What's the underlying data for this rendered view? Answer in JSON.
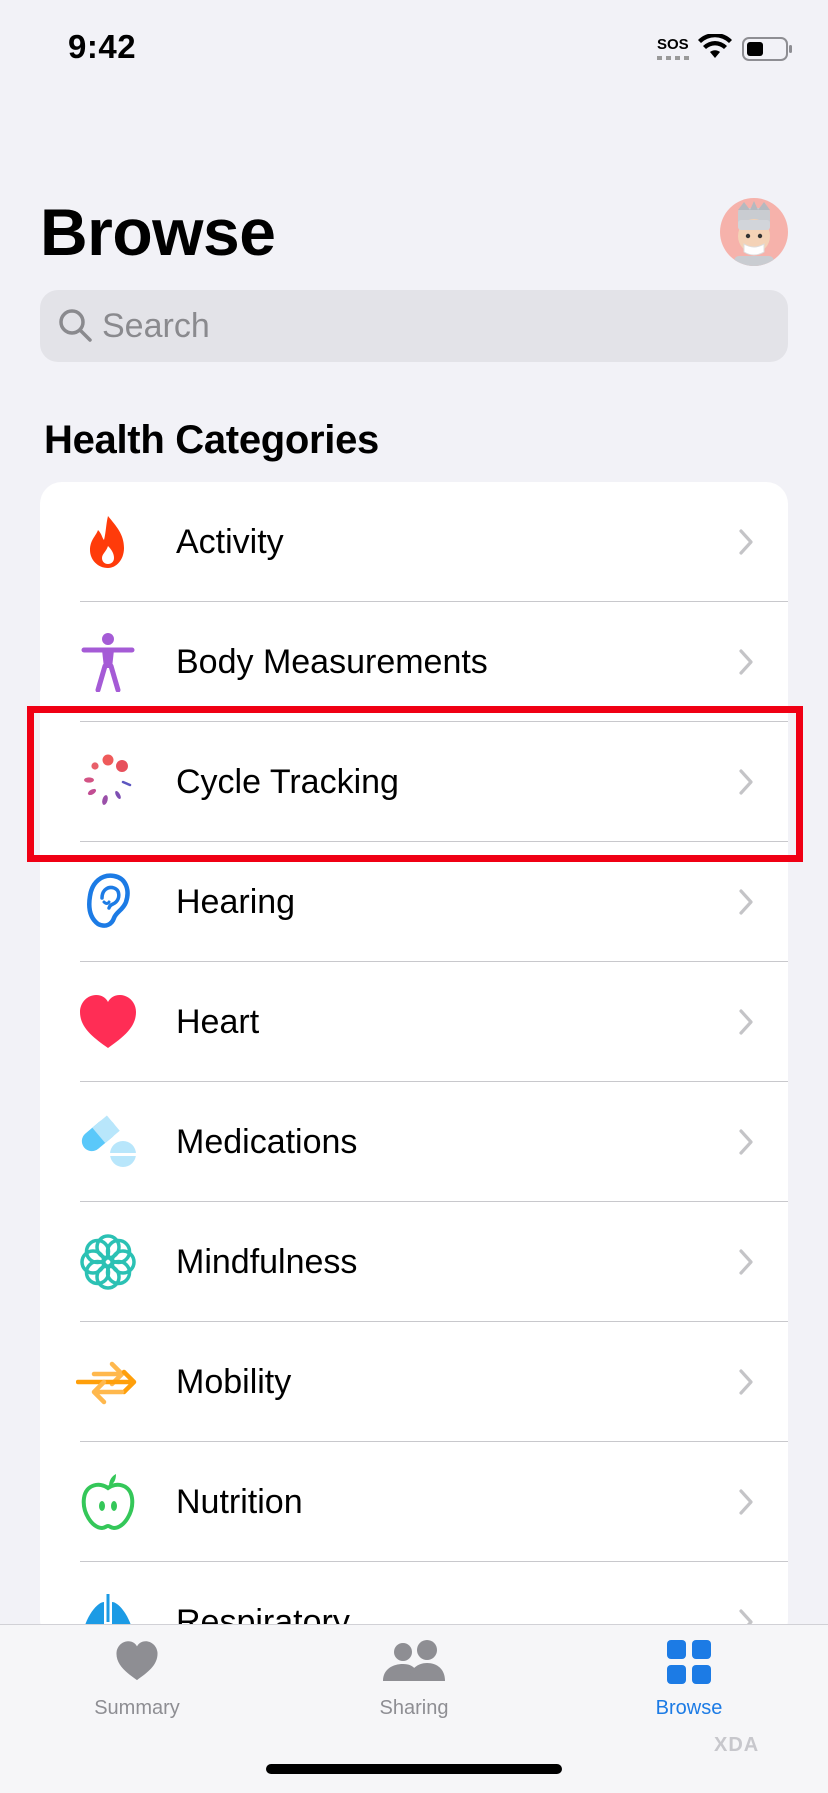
{
  "status_bar": {
    "time": "9:42",
    "carrier": "SOS"
  },
  "header": {
    "title": "Browse"
  },
  "search": {
    "placeholder": "Search"
  },
  "section": {
    "title": "Health Categories"
  },
  "categories": [
    {
      "label": "Activity",
      "icon": "flame-icon",
      "color": "#FF3B0A"
    },
    {
      "label": "Body Measurements",
      "icon": "figure-icon",
      "color": "#A55BD6"
    },
    {
      "label": "Cycle Tracking",
      "icon": "cycle-icon",
      "color": "#E8606A"
    },
    {
      "label": "Hearing",
      "icon": "ear-icon",
      "color": "#1C7BE5"
    },
    {
      "label": "Heart",
      "icon": "heart-icon",
      "color": "#FF2D55"
    },
    {
      "label": "Medications",
      "icon": "pills-icon",
      "color": "#5AC8FA"
    },
    {
      "label": "Mindfulness",
      "icon": "flower-icon",
      "color": "#2BC1B4"
    },
    {
      "label": "Mobility",
      "icon": "arrows-icon",
      "color": "#FF9F0A"
    },
    {
      "label": "Nutrition",
      "icon": "apple-icon",
      "color": "#34C759"
    },
    {
      "label": "Respiratory",
      "icon": "lungs-icon",
      "color": "#1C9BE5"
    }
  ],
  "tabbar": {
    "tabs": [
      {
        "label": "Summary",
        "icon": "heart-icon",
        "active": false
      },
      {
        "label": "Sharing",
        "icon": "people-icon",
        "active": false
      },
      {
        "label": "Browse",
        "icon": "grid-icon",
        "active": true
      }
    ]
  },
  "watermark": "XDA"
}
